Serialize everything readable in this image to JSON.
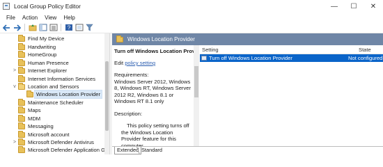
{
  "window": {
    "title": "Local Group Policy Editor",
    "minimize": "—",
    "maximize": "☐",
    "close": "✕"
  },
  "menu": [
    "File",
    "Action",
    "View",
    "Help"
  ],
  "toolbar": {
    "icons": [
      "back-icon",
      "forward-icon",
      "folder-up-icon",
      "show-hide-tree-icon",
      "export-list-icon",
      "help-icon",
      "properties-icon",
      "filter-icon"
    ]
  },
  "tree": {
    "items": [
      {
        "label": "Find My Device"
      },
      {
        "label": "Handwriting"
      },
      {
        "label": "HomeGroup"
      },
      {
        "label": "Human Presence"
      },
      {
        "label": "Internet Explorer",
        "expander": ">"
      },
      {
        "label": "Internet Information Services"
      },
      {
        "label": "Location and Sensors",
        "expander": "v"
      },
      {
        "label": "Windows Location Provider",
        "selected": true
      },
      {
        "label": "Maintenance Scheduler"
      },
      {
        "label": "Maps"
      },
      {
        "label": "MDM"
      },
      {
        "label": "Messaging"
      },
      {
        "label": "Microsoft account"
      },
      {
        "label": "Microsoft Defender Antivirus",
        "expander": ">"
      },
      {
        "label": "Microsoft Defender Application Gu"
      }
    ]
  },
  "header": {
    "title": "Windows Location Provider"
  },
  "description": {
    "policy_title": "Turn off Windows Location Provider",
    "edit_prefix": "Edit ",
    "edit_link": "policy setting",
    "requirements": "Requirements:\nWindows Server 2012, Windows 8, Windows RT, Windows Server 2012 R2, Windows 8.1 or Windows RT 8.1 only",
    "description_label": "Description:",
    "body": "This policy setting turns off the Windows Location Provider feature for this computer."
  },
  "list": {
    "columns": {
      "setting": "Setting",
      "state": "State"
    },
    "rows": [
      {
        "setting": "Turn off Windows Location Provider",
        "state": "Not configured",
        "selected": true
      }
    ]
  },
  "tabs": {
    "extended": "Extended",
    "standard": "Standard"
  },
  "colors": {
    "header_bg": "#6f86a6",
    "selection": "#0a64c9",
    "folder": "#e8c15a"
  }
}
